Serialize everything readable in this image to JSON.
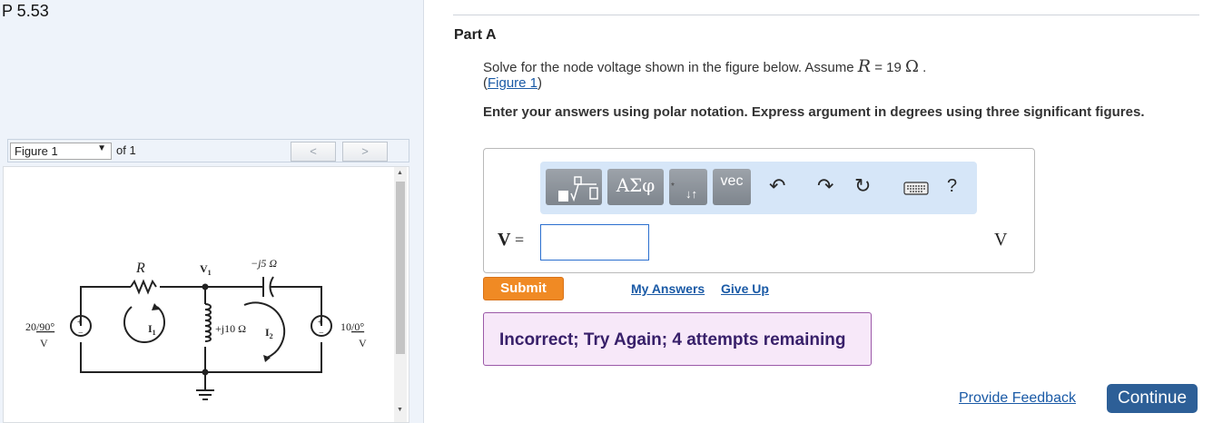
{
  "problem": {
    "title": "P 5.53"
  },
  "figure_nav": {
    "selected": "Figure 1",
    "of_label": "of 1",
    "prev_label": "<",
    "next_label": ">"
  },
  "circuit": {
    "r_label": "R",
    "node_label": "V",
    "node_sub": "1",
    "cap_label": "−j5 Ω",
    "ind_label": "+j10 Ω",
    "left_source": {
      "mag": "20",
      "angle": "/90°",
      "unit": "V"
    },
    "right_source": {
      "mag": "10",
      "angle": "/0°",
      "unit": "V"
    },
    "i1": "I",
    "i1_sub": "1",
    "i2": "I",
    "i2_sub": "2",
    "plus": "+",
    "minus": "−"
  },
  "part": {
    "title": "Part A",
    "question_prefix": "Solve for the node voltage shown in the figure below. Assume ",
    "question_var": "R",
    "question_eq": " = 19 ",
    "question_unit": "Ω",
    "question_end": " .",
    "figure_link_open": "(",
    "figure_link": "Figure 1",
    "figure_link_close": ")",
    "instructions": "Enter your answers using polar notation. Express argument in degrees using three significant figures."
  },
  "toolbar": {
    "templates": "templates",
    "greek": "ΑΣφ",
    "arrows": "↓↑",
    "vec": "vec",
    "undo": "undo",
    "redo": "redo",
    "reset": "reset",
    "keyboard": "keyboard",
    "help": "?"
  },
  "answer": {
    "label": "V",
    "eq": " =",
    "value": "",
    "unit": "V"
  },
  "actions": {
    "submit": "Submit",
    "my_answers": "My Answers",
    "give_up": "Give Up"
  },
  "feedback": {
    "message": "Incorrect; Try Again; 4 attempts remaining"
  },
  "footer": {
    "provide_feedback": "Provide Feedback",
    "continue": "Continue"
  },
  "colors": {
    "submit": "#f08a24",
    "continue": "#2d5f97",
    "link": "#1a5aa6",
    "feedback_bg": "#f7e8f9",
    "feedback_border": "#9b59a8",
    "toolbar_bg": "#d6e6f8"
  }
}
